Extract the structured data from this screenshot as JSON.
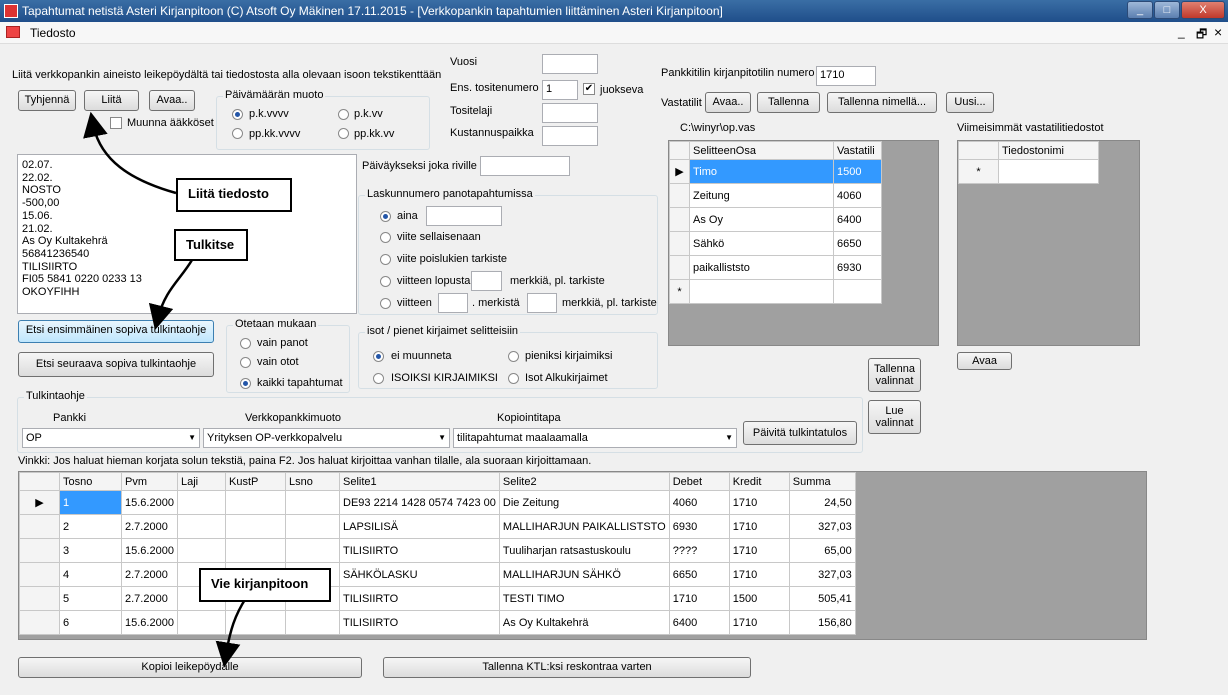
{
  "window": {
    "title": "Tapahtumat netistä Asteri Kirjanpitoon   (C) Atsoft Oy Mäkinen 17.11.2015 - [Verkkopankin tapahtumien liittäminen Asteri Kirjanpitoon]",
    "minimize": "_",
    "maximize": "□",
    "close": "X"
  },
  "menu": {
    "file": "Tiedosto",
    "mdi_min": "_",
    "mdi_restore": "🗗",
    "mdi_close": "×"
  },
  "top": {
    "instruction": "Liitä verkkopankin aineisto leikepöydältä tai tiedostosta alla olevaan isoon tekstikenttään",
    "clear_btn": "Tyhjennä",
    "paste_btn": "Liitä",
    "open_btn": "Avaa..",
    "convert_chk": "Muunna ääkköset"
  },
  "date_format": {
    "label": "Päivämäärän muoto",
    "opt1": "p.k.vvvv",
    "opt2": "p.k.vv",
    "opt3": "pp.kk.vvvv",
    "opt4": "pp.kk.vv"
  },
  "fields": {
    "year_label": "Vuosi",
    "year_value": "",
    "first_voucher_label": "Ens. tositenumero",
    "first_voucher_value": "1",
    "flexible_label": "juokseva",
    "voucher_type_label": "Tositelaji",
    "cost_center_label": "Kustannuspaikka",
    "date_every_row_label": "Päiväykseksi joka riville"
  },
  "invoice_number": {
    "label": "Laskunnumero panotapahtumissa",
    "opt_always": "aina",
    "opt_ref": "viite sellaisenaan",
    "opt_ref_no_check": "viite poislukien tarkiste",
    "opt_ref_end": "viitteen lopusta",
    "chars_no_check": "merkkiä, pl. tarkiste",
    "opt_ref2": "viitteen",
    "chars_from": ". merkistä",
    "chars_no_check2": "merkkiä, pl. tarkiste"
  },
  "paste_text": "02.07.\n22.02.\nNOSTO\n-500,00\n15.06.\n21.02.\nAs Oy Kultakehrä\n56841236540\nTILISIIRTO\nFI05 5841 0220 0233 13\nOKOYFIHH",
  "find_first_btn": "Etsi ensimmäinen sopiva tulkintaohje",
  "find_next_btn": "Etsi seuraava sopiva tulkintaohje",
  "include": {
    "label": "Otetaan mukaan",
    "opt1": "vain panot",
    "opt2": "vain otot",
    "opt3": "kaikki tapahtumat"
  },
  "case": {
    "label": "isot / pienet kirjaimet selitteisiin",
    "opt1": "ei muunneta",
    "opt2": "pieniksi kirjaimiksi",
    "opt3": "ISOIKSI KIRJAIMIKSI",
    "opt4": "Isot Alkukirjaimet"
  },
  "account": {
    "bank_account_label": "Pankkitilin kirjanpitotilin numero",
    "bank_account_value": "1710",
    "counter_label": "Vastatilit",
    "open_btn": "Avaa..",
    "save_btn": "Tallenna",
    "save_as_btn": "Tallenna nimellä...",
    "new_btn": "Uusi...",
    "path": "C:\\winyr\\op.vas",
    "recent_label": "Viimeisimmät vastatilitiedostot"
  },
  "counter_grid": {
    "headers": [
      "SelitteenOsa",
      "Vastatili"
    ],
    "rows": [
      [
        "Timo",
        "1500"
      ],
      [
        "Zeitung",
        "4060"
      ],
      [
        "As Oy",
        "6400"
      ],
      [
        "Sähkö",
        "6650"
      ],
      [
        "paikalliststo",
        "6930"
      ]
    ],
    "new_row_marker": "*"
  },
  "recent_grid": {
    "header": "Tiedostonimi",
    "new_row_marker": "*",
    "open_btn": "Avaa"
  },
  "side_buttons": {
    "save_sel": "Tallenna valinnat",
    "read_sel": "Lue valinnat"
  },
  "interpretation": {
    "label": "Tulkintaohje",
    "bank_label": "Pankki",
    "bank_value": "OP",
    "format_label": "Verkkopankkimuoto",
    "format_value": "Yrityksen OP-verkkopalvelu",
    "copy_label": "Kopiointitapa",
    "copy_value": "tilitapahtumat maalaamalla",
    "update_btn": "Päivitä tulkintatulos"
  },
  "hint": "Vinkki: Jos haluat hieman korjata solun tekstiä, paina F2. Jos haluat kirjoittaa vanhan tilalle, ala suoraan kirjoittamaan.",
  "result_grid": {
    "headers": [
      "Tosno",
      "Pvm",
      "Laji",
      "KustP",
      "Lsno",
      "Selite1",
      "Selite2",
      "Debet",
      "Kredit",
      "Summa"
    ],
    "rows": [
      [
        "1",
        "15.6.2000",
        "",
        "",
        "",
        "DE93 2214 1428 0574 7423 00",
        "Die Zeitung",
        "4060",
        "1710",
        "24,50"
      ],
      [
        "2",
        "2.7.2000",
        "",
        "",
        "",
        "LAPSILISÄ",
        "MALLIHARJUN PAIKALLISTSTO",
        "6930",
        "1710",
        "327,03"
      ],
      [
        "3",
        "15.6.2000",
        "",
        "",
        "",
        "TILISIIRTO",
        "Tuuliharjan ratsastuskoulu",
        "????",
        "1710",
        "65,00"
      ],
      [
        "4",
        "2.7.2000",
        "",
        "",
        "",
        "SÄHKÖLASKU",
        "MALLIHARJUN SÄHKÖ",
        "6650",
        "1710",
        "327,03"
      ],
      [
        "5",
        "2.7.2000",
        "",
        "",
        "",
        "TILISIIRTO",
        "TESTI TIMO",
        "1710",
        "1500",
        "505,41"
      ],
      [
        "6",
        "15.6.2000",
        "",
        "",
        "",
        "TILISIIRTO",
        "As Oy Kultakehrä",
        "6400",
        "1710",
        "156,80"
      ]
    ]
  },
  "bottom": {
    "copy_btn": "Kopioi leikepöydälle",
    "save_ktl_btn": "Tallenna KTL:ksi reskontraa varten"
  },
  "callouts": {
    "paste_file": "Liitä tiedosto",
    "interpret": "Tulkitse",
    "export": "Vie kirjanpitoon"
  }
}
